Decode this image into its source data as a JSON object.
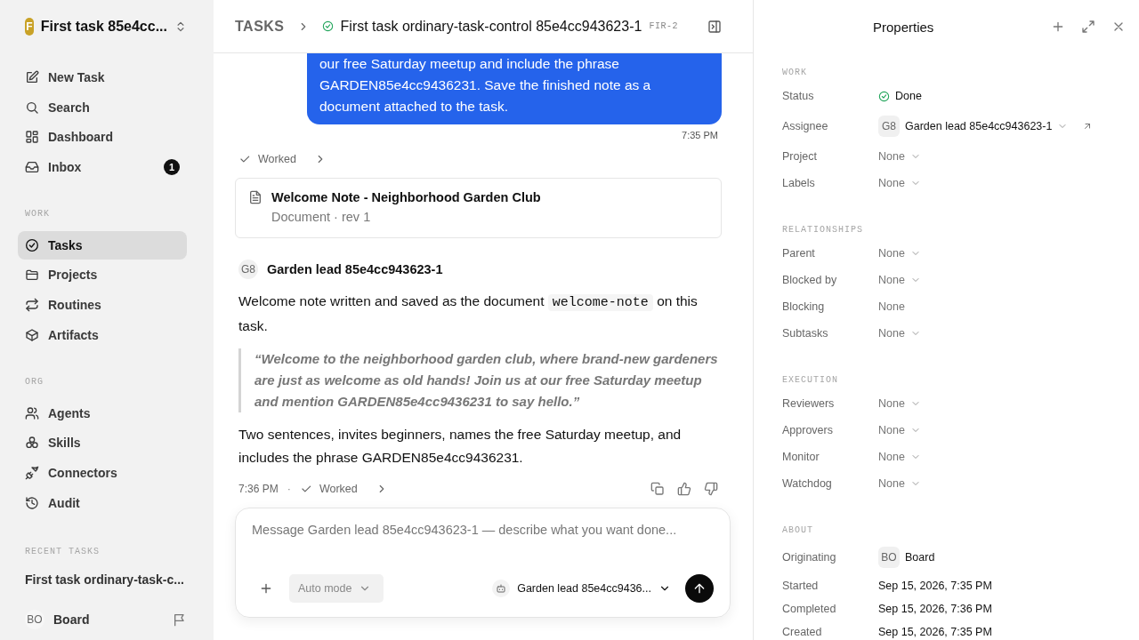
{
  "sidebar": {
    "workspace": {
      "initial": "F",
      "name": "First task 85e4cc..."
    },
    "nav": [
      {
        "label": "New Task",
        "selected": false
      },
      {
        "label": "Search",
        "selected": false
      },
      {
        "label": "Dashboard",
        "selected": false
      },
      {
        "label": "Inbox",
        "selected": false,
        "badge": "1"
      }
    ],
    "sections": [
      {
        "title": "WORK",
        "items": [
          {
            "label": "Tasks",
            "selected": true
          },
          {
            "label": "Projects",
            "selected": false
          },
          {
            "label": "Routines",
            "selected": false
          },
          {
            "label": "Artifacts",
            "selected": false
          }
        ]
      },
      {
        "title": "ORG",
        "items": [
          {
            "label": "Agents",
            "selected": false
          },
          {
            "label": "Skills",
            "selected": false
          },
          {
            "label": "Connectors",
            "selected": false
          },
          {
            "label": "Audit",
            "selected": false
          }
        ]
      }
    ],
    "recent": {
      "title": "RECENT TASKS",
      "items": [
        "First task ordinary-task-c..."
      ]
    },
    "footer": {
      "initials": "BO",
      "name": "Board"
    }
  },
  "header": {
    "root": "TASKS",
    "done": true,
    "title": "First task ordinary-task-control 85e4cc943623-1",
    "code": "FIR-2"
  },
  "thread": {
    "user_message": {
      "text": "our free Saturday meetup and include the phrase GARDEN85e4cc9436231. Save the finished note as a document attached to the task.",
      "time": "7:35 PM"
    },
    "worked": {
      "label": "Worked"
    },
    "document": {
      "title": "Welcome Note - Neighborhood Garden Club",
      "meta": "Document · rev 1"
    },
    "agent_message": {
      "initials": "G8",
      "name": "Garden lead 85e4cc943623-1",
      "intro": {
        "before": "Welcome note written and saved as the document ",
        "code": "welcome-note",
        "after": " on this task."
      },
      "quote": "“Welcome to the neighborhood garden club, where brand-new gardeners are just as welcome as old hands! Join us at our free Saturday meetup and mention GARDEN85e4cc9436231 to say hello.”",
      "summary": "Two sentences, invites beginners, names the free Saturday meetup, and includes the phrase GARDEN85e4cc9436231.",
      "time": "7:36 PM",
      "separator": "·",
      "worked": "Worked"
    }
  },
  "composer": {
    "placeholder": "Message Garden lead 85e4cc943623-1 — describe what you want done...",
    "mode": "Auto mode",
    "agent": "Garden lead 85e4cc9436..."
  },
  "properties": {
    "title": "Properties",
    "sections": [
      {
        "title": "WORK",
        "rows": [
          {
            "label": "Status",
            "kind": "status",
            "value": "Done",
            "caret": false
          },
          {
            "label": "Assignee",
            "kind": "person",
            "initials": "G8",
            "value": "Garden lead 85e4cc943623-1",
            "caret": true,
            "link": true
          },
          {
            "label": "Project",
            "kind": "select",
            "value": "None",
            "caret": true
          },
          {
            "label": "Labels",
            "kind": "select",
            "value": "None",
            "caret": true
          }
        ]
      },
      {
        "title": "RELATIONSHIPS",
        "rows": [
          {
            "label": "Parent",
            "kind": "select",
            "value": "None",
            "caret": true
          },
          {
            "label": "Blocked by",
            "kind": "select",
            "value": "None",
            "caret": true
          },
          {
            "label": "Blocking",
            "kind": "select",
            "value": "None",
            "caret": false
          },
          {
            "label": "Subtasks",
            "kind": "select",
            "value": "None",
            "caret": true
          }
        ]
      },
      {
        "title": "EXECUTION",
        "rows": [
          {
            "label": "Reviewers",
            "kind": "select",
            "value": "None",
            "caret": true
          },
          {
            "label": "Approvers",
            "kind": "select",
            "value": "None",
            "caret": true
          },
          {
            "label": "Monitor",
            "kind": "select",
            "value": "None",
            "caret": true
          },
          {
            "label": "Watchdog",
            "kind": "select",
            "value": "None",
            "caret": true
          }
        ]
      },
      {
        "title": "ABOUT",
        "rows": [
          {
            "label": "Originating",
            "kind": "person",
            "initials": "BO",
            "value": "Board",
            "caret": false
          },
          {
            "label": "Started",
            "kind": "date",
            "value": "Sep 15, 2026, 7:35 PM",
            "caret": false
          },
          {
            "label": "Completed",
            "kind": "date",
            "value": "Sep 15, 2026, 7:36 PM",
            "caret": false
          },
          {
            "label": "Created",
            "kind": "date",
            "value": "Sep 15, 2026, 7:35 PM",
            "caret": false
          }
        ]
      }
    ]
  }
}
